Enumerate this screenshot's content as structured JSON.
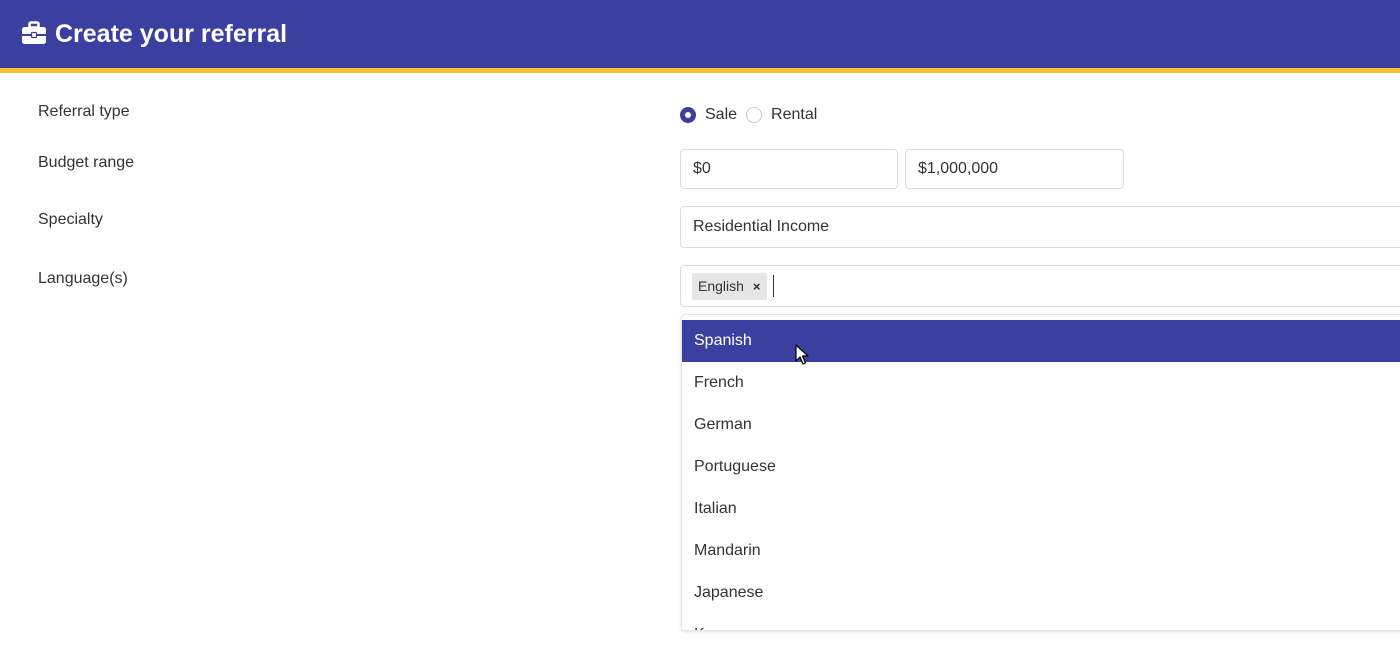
{
  "header": {
    "icon": "briefcase-icon",
    "title": "Create your referral",
    "colors": {
      "bar": "#3b40a0",
      "accent": "#f2c230"
    }
  },
  "form": {
    "referral_type": {
      "label": "Referral type",
      "options": [
        {
          "label": "Sale",
          "checked": true
        },
        {
          "label": "Rental",
          "checked": false
        }
      ]
    },
    "budget_range": {
      "label": "Budget range",
      "min_value": "$0",
      "max_value": "$1,000,000"
    },
    "specialty": {
      "label": "Specialty",
      "value": "Residential Income"
    },
    "languages": {
      "label": "Language(s)",
      "selected": [
        {
          "label": "English",
          "remove_glyph": "×"
        }
      ],
      "dropdown_options": [
        {
          "label": "Spanish",
          "highlighted": true
        },
        {
          "label": "French"
        },
        {
          "label": "German"
        },
        {
          "label": "Portuguese"
        },
        {
          "label": "Italian"
        },
        {
          "label": "Mandarin"
        },
        {
          "label": "Japanese"
        },
        {
          "label": "K"
        }
      ]
    }
  }
}
